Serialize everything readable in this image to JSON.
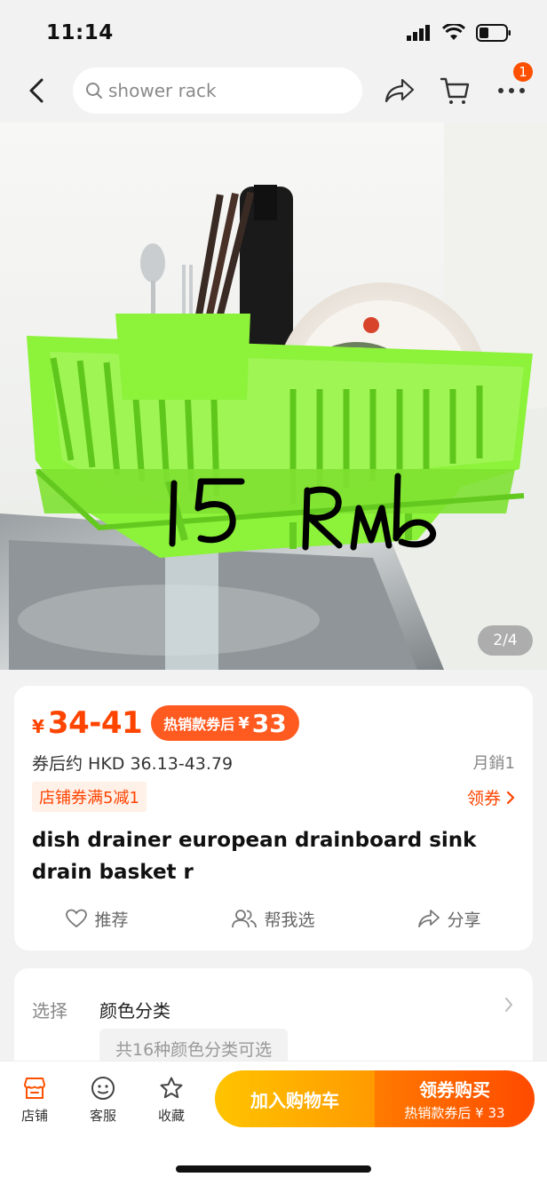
{
  "status_bar": {
    "time": "11:14"
  },
  "search": {
    "query": "shower rack"
  },
  "header": {
    "menu_badge_count": "1"
  },
  "image": {
    "handwritten_price": "15 Rmb",
    "counter": "2/4"
  },
  "price": {
    "currency": "¥",
    "range": "34-41",
    "hot_label": "热销款券后",
    "hot_currency": "¥",
    "hot_price": "33",
    "hkd_text": "券后约 HKD 36.13-43.79",
    "monthly_sales": "月銷1",
    "shop_coupon": "店铺券满5减1",
    "claim_coupon": "领券"
  },
  "product": {
    "title": "dish drainer european drainboard  sink drain basket r"
  },
  "actions": [
    {
      "label": "推荐",
      "icon": "heart-icon"
    },
    {
      "label": "帮我选",
      "icon": "people-icon"
    },
    {
      "label": "分享",
      "icon": "share-icon"
    }
  ],
  "select": {
    "label": "选择",
    "value": "颜色分类",
    "options_hint": "共16种颜色分类可选"
  },
  "bottom_bar": {
    "tabs": [
      {
        "label": "店铺",
        "icon": "store-icon"
      },
      {
        "label": "客服",
        "icon": "customer-service-icon"
      },
      {
        "label": "收藏",
        "icon": "star-icon"
      }
    ],
    "add_to_cart": "加入购物车",
    "buy_main": "领券购买",
    "buy_sub": "热销款券后 ¥ 33"
  },
  "colors": {
    "accent": "#ff4400",
    "cart_button": "#ffb300",
    "buy_button": "#ff5a00",
    "basket_green": "#8cf23a"
  }
}
